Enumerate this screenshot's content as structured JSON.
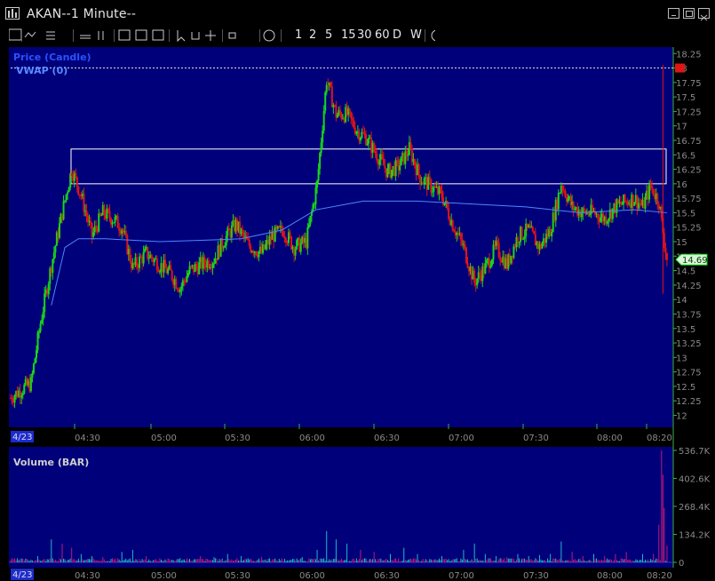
{
  "window": {
    "title": "AKAN--1 Minute--"
  },
  "toolbar": {
    "intervals": [
      "1",
      "2",
      "5",
      "15",
      "30",
      "60",
      "D",
      "W"
    ]
  },
  "colors": {
    "bg": "#00007a",
    "up": "#19d619",
    "down": "#e01515",
    "vwap": "#4f87ff",
    "vol_up": "#1fb8c8",
    "vol_down": "#c01a78",
    "axis": "#3fae3f",
    "zone": "#ffffff"
  },
  "chart_data": [
    {
      "type": "candlestick",
      "series": [
        {
          "name": "Price (Candle)"
        },
        {
          "name": "VWAP (0)"
        }
      ],
      "ylim": [
        11.9,
        18.3
      ],
      "yticks": [
        12,
        12.25,
        12.5,
        12.75,
        13,
        13.25,
        13.5,
        13.75,
        14,
        14.25,
        14.5,
        14.75,
        15,
        15.25,
        15.5,
        15.75,
        16,
        16.25,
        16.5,
        16.75,
        17,
        17.25,
        17.5,
        17.75,
        18,
        18.25
      ],
      "ytick_labels": [
        "12",
        "12.25",
        "12.5",
        "12.75",
        "13",
        "13.25",
        "13.5",
        "13.75",
        "14",
        "14.25",
        "14.5",
        "14.75",
        "15",
        "15.25",
        "15.5",
        "15.75",
        "16",
        "16.25",
        "16.5",
        "16.75",
        "17",
        "17.25",
        "17.5",
        "17.75",
        "18",
        "18.25"
      ],
      "date_label": "4/23",
      "xticks": [
        "04:30",
        "05:00",
        "05:30",
        "06:00",
        "06:30",
        "07:00",
        "07:30",
        "08:00",
        "08:20"
      ],
      "last_price": "14.69",
      "zone": {
        "low": 16.0,
        "high": 16.6
      },
      "ref_line": 18.0,
      "ohlc_close_path": [
        [
          0,
          12.3
        ],
        [
          8,
          12.45
        ],
        [
          15,
          12.55
        ],
        [
          22,
          13.6
        ],
        [
          30,
          14.6
        ],
        [
          38,
          15.5
        ],
        [
          45,
          16.25
        ],
        [
          52,
          15.8
        ],
        [
          60,
          15.1
        ],
        [
          68,
          15.5
        ],
        [
          75,
          15.4
        ],
        [
          82,
          15.25
        ],
        [
          90,
          14.55
        ],
        [
          100,
          14.8
        ],
        [
          110,
          14.6
        ],
        [
          118,
          14.45
        ],
        [
          125,
          14.2
        ],
        [
          132,
          14.5
        ],
        [
          140,
          14.6
        ],
        [
          150,
          14.7
        ],
        [
          158,
          15.05
        ],
        [
          166,
          15.3
        ],
        [
          175,
          14.95
        ],
        [
          185,
          14.8
        ],
        [
          193,
          15.1
        ],
        [
          201,
          15.2
        ],
        [
          209,
          14.9
        ],
        [
          218,
          15.0
        ],
        [
          226,
          16.0
        ],
        [
          233,
          17.8
        ],
        [
          240,
          17.2
        ],
        [
          248,
          17.2
        ],
        [
          256,
          16.9
        ],
        [
          262,
          16.8
        ],
        [
          270,
          16.5
        ],
        [
          278,
          16.2
        ],
        [
          286,
          16.3
        ],
        [
          294,
          16.6
        ],
        [
          302,
          16.1
        ],
        [
          310,
          15.95
        ],
        [
          318,
          15.8
        ],
        [
          326,
          15.3
        ],
        [
          334,
          14.9
        ],
        [
          342,
          14.3
        ],
        [
          350,
          14.55
        ],
        [
          358,
          14.9
        ],
        [
          366,
          14.6
        ],
        [
          374,
          15.1
        ],
        [
          382,
          15.2
        ],
        [
          390,
          14.9
        ],
        [
          398,
          15.2
        ],
        [
          406,
          16.0
        ],
        [
          414,
          15.6
        ],
        [
          422,
          15.5
        ],
        [
          430,
          15.5
        ],
        [
          438,
          15.4
        ],
        [
          446,
          15.6
        ],
        [
          454,
          15.7
        ],
        [
          460,
          15.75
        ],
        [
          466,
          15.6
        ],
        [
          472,
          15.95
        ],
        [
          478,
          15.7
        ],
        [
          482,
          15.0
        ],
        [
          484,
          14.69
        ]
      ],
      "vwap": [
        [
          30,
          13.9
        ],
        [
          40,
          14.9
        ],
        [
          50,
          15.05
        ],
        [
          70,
          15.05
        ],
        [
          110,
          15.0
        ],
        [
          150,
          15.03
        ],
        [
          170,
          15.05
        ],
        [
          200,
          15.2
        ],
        [
          225,
          15.55
        ],
        [
          260,
          15.7
        ],
        [
          300,
          15.7
        ],
        [
          340,
          15.65
        ],
        [
          380,
          15.6
        ],
        [
          420,
          15.5
        ],
        [
          460,
          15.55
        ],
        [
          484,
          15.5
        ]
      ],
      "volume_ylim": [
        0,
        536.7
      ],
      "volume_ticks": [
        "0",
        "134.2K",
        "268.4K",
        "402.6K",
        "536.7K"
      ],
      "volume_title": "Volume (BAR)",
      "volume_bars": [
        [
          5,
          20
        ],
        [
          20,
          30
        ],
        [
          30,
          110
        ],
        [
          38,
          90
        ],
        [
          45,
          70
        ],
        [
          52,
          40
        ],
        [
          60,
          30
        ],
        [
          68,
          25
        ],
        [
          75,
          20
        ],
        [
          82,
          50
        ],
        [
          90,
          60
        ],
        [
          100,
          30
        ],
        [
          110,
          20
        ],
        [
          125,
          20
        ],
        [
          140,
          30
        ],
        [
          150,
          25
        ],
        [
          160,
          40
        ],
        [
          170,
          30
        ],
        [
          185,
          25
        ],
        [
          200,
          20
        ],
        [
          215,
          25
        ],
        [
          226,
          60
        ],
        [
          233,
          150
        ],
        [
          240,
          110
        ],
        [
          248,
          90
        ],
        [
          258,
          60
        ],
        [
          268,
          50
        ],
        [
          280,
          40
        ],
        [
          290,
          70
        ],
        [
          300,
          40
        ],
        [
          318,
          30
        ],
        [
          334,
          60
        ],
        [
          342,
          90
        ],
        [
          350,
          40
        ],
        [
          358,
          30
        ],
        [
          366,
          25
        ],
        [
          374,
          40
        ],
        [
          382,
          30
        ],
        [
          390,
          35
        ],
        [
          398,
          40
        ],
        [
          406,
          100
        ],
        [
          414,
          50
        ],
        [
          422,
          30
        ],
        [
          430,
          40
        ],
        [
          438,
          30
        ],
        [
          446,
          40
        ],
        [
          454,
          50
        ],
        [
          466,
          40
        ],
        [
          474,
          40
        ],
        [
          478,
          180
        ],
        [
          480,
          536
        ],
        [
          481,
          420
        ],
        [
          482,
          260
        ],
        [
          484,
          80
        ]
      ]
    }
  ]
}
